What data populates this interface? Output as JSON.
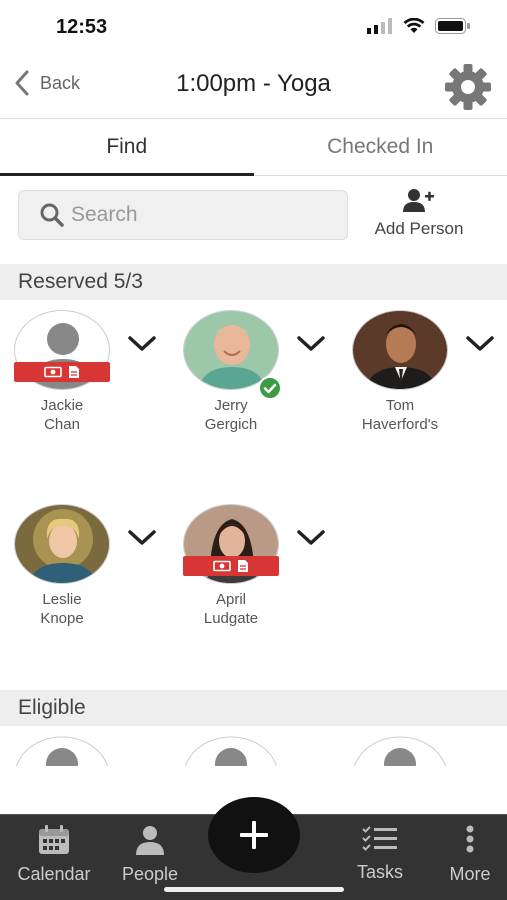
{
  "status_bar": {
    "time": "12:53"
  },
  "nav": {
    "back_label": "Back",
    "title": "1:00pm - Yoga"
  },
  "tabs": [
    {
      "label": "Find"
    },
    {
      "label": "Checked In"
    }
  ],
  "search": {
    "placeholder": "Search"
  },
  "add_person": {
    "label": "Add Person"
  },
  "sections": {
    "reserved": {
      "title": "Reserved 5/3"
    },
    "eligible": {
      "title": "Eligible"
    }
  },
  "reserved_people": [
    {
      "first": "Jackie",
      "last": "Chan",
      "has_photo": false,
      "badge": "payment-document",
      "checked_in": false
    },
    {
      "first": "Jerry",
      "last": "Gergich",
      "has_photo": true,
      "badge": null,
      "checked_in": true
    },
    {
      "first": "Tom",
      "last": "Haverford's",
      "has_photo": true,
      "badge": null,
      "checked_in": false
    },
    {
      "first": "Leslie",
      "last": "Knope",
      "has_photo": true,
      "badge": null,
      "checked_in": false
    },
    {
      "first": "April",
      "last": "Ludgate",
      "has_photo": true,
      "badge": "payment-document",
      "checked_in": false
    }
  ],
  "bottom_tabs": [
    {
      "label": "Calendar",
      "icon": "calendar-icon"
    },
    {
      "label": "People",
      "icon": "person-icon"
    },
    {
      "label": "Tasks",
      "icon": "checklist-icon"
    },
    {
      "label": "More",
      "icon": "more-icon"
    }
  ],
  "colors": {
    "badge_red": "#d83535",
    "check_green": "#3d9b44",
    "tab_bar": "#333333",
    "fab": "#111111"
  }
}
